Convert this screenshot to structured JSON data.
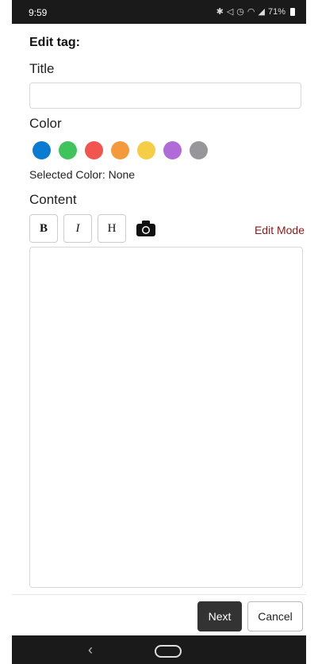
{
  "status_bar": {
    "time": "9:59",
    "icons": [
      "bluetooth-icon",
      "mute-icon",
      "alarm-icon",
      "wifi-icon",
      "signal-icon"
    ],
    "battery": "71%"
  },
  "page": {
    "heading": "Edit tag:",
    "title_label": "Title",
    "title_value": "",
    "color_label": "Color",
    "colors": [
      {
        "name": "blue",
        "hex": "#0a7bd3"
      },
      {
        "name": "green",
        "hex": "#3fc35a"
      },
      {
        "name": "red",
        "hex": "#f25550"
      },
      {
        "name": "orange",
        "hex": "#f59a3c"
      },
      {
        "name": "yellow",
        "hex": "#f5ce46"
      },
      {
        "name": "purple",
        "hex": "#b06bd8"
      },
      {
        "name": "gray",
        "hex": "#97979b"
      }
    ],
    "selected_color_text": "Selected Color: None",
    "content_label": "Content",
    "toolbar": {
      "bold": "B",
      "italic": "I",
      "heading": "H",
      "edit_mode": "Edit Mode"
    }
  },
  "footer": {
    "next": "Next",
    "cancel": "Cancel"
  },
  "nav": {
    "back": "‹"
  }
}
